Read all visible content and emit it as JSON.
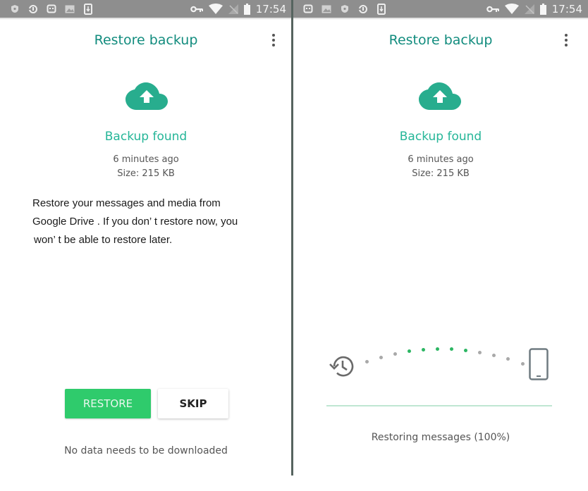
{
  "colors": {
    "accent": "#128c7e",
    "found": "#25b698",
    "restore_button": "#2fcb6c",
    "dot_active": "#2cb663",
    "dot_inactive": "#a9a9a9",
    "statusbar": "#8e8e8e"
  },
  "statusbar_left": {
    "notification_icons": [
      "shield-icon",
      "sync-icon",
      "message-icon",
      "image-icon",
      "download-icon"
    ],
    "system_icons": [
      "key-icon",
      "wifi-icon",
      "no-signal-icon",
      "battery-icon"
    ],
    "time": "17:54"
  },
  "statusbar_right": {
    "notification_icons": [
      "message-icon",
      "image-icon",
      "shield-icon",
      "sync-icon",
      "download-icon"
    ],
    "system_icons": [
      "key-icon",
      "wifi-icon",
      "no-signal-icon",
      "battery-icon"
    ],
    "time": "17:54"
  },
  "left": {
    "title": "Restore backup",
    "menu_icon": "more-vert-icon",
    "cloud_icon": "cloud-upload-icon",
    "backup_found": "Backup found",
    "time_ago": "6 minutes ago",
    "size": "Size: 215 KB",
    "description_lines": [
      "Restore your messages and media from",
      "Google Drive . If you don’ t restore now, you",
      "won’ t be able to restore later."
    ],
    "restore_button": "RESTORE",
    "skip_button": "SKIP",
    "footer_note": "No data needs to be downloaded"
  },
  "right": {
    "title": "Restore backup",
    "menu_icon": "more-vert-icon",
    "cloud_icon": "cloud-upload-icon",
    "backup_found": "Backup found",
    "time_ago": "6 minutes ago",
    "size": "Size: 215 KB",
    "source_icon": "history-icon",
    "target_icon": "phone-icon",
    "dots": [
      "inactive",
      "inactive",
      "inactive",
      "active",
      "active",
      "active",
      "active",
      "active",
      "inactive",
      "inactive",
      "inactive",
      "inactive"
    ],
    "progress_percent": 100,
    "status": "Restoring messages (100%)"
  }
}
